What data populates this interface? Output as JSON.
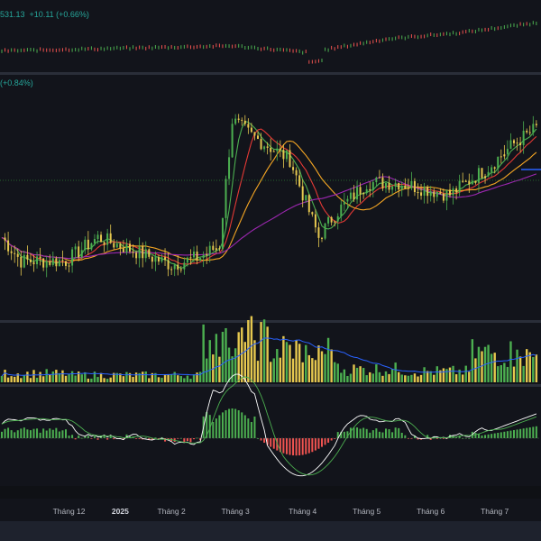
{
  "header": {
    "index_price": "531.13",
    "index_change": "+10.11 (+0.66%)",
    "main_change": "(+0.84%)"
  },
  "x_axis": {
    "ticks": [
      {
        "label": "Tháng 12",
        "bold": false
      },
      {
        "label": "2025",
        "bold": true
      },
      {
        "label": "Tháng 2",
        "bold": false
      },
      {
        "label": "Tháng 3",
        "bold": false
      },
      {
        "label": "Tháng 4",
        "bold": false
      },
      {
        "label": "Tháng 5",
        "bold": false
      },
      {
        "label": "Tháng 6",
        "bold": false
      },
      {
        "label": "Tháng 7",
        "bold": false
      }
    ]
  },
  "colors": {
    "up": "#4caf50",
    "down": "#ef5350",
    "doji": "#e6c84f",
    "ma_fast": "#4caf50",
    "ma_mid": "#e53935",
    "ma_slow": "#f5a623",
    "ma_long": "#9c27b0",
    "vol_ma": "#2962ff",
    "macd": "#ffffff",
    "signal": "#4caf50",
    "hist_up": "#4caf50",
    "hist_down": "#ef5350",
    "resistance": "#2962ff"
  },
  "chart_data": [
    {
      "type": "line",
      "pane": "index-overview",
      "x": [
        "Tháng 12",
        "2025",
        "Tháng 2",
        "Tháng 3",
        "Tháng 4",
        "Tháng 5",
        "Tháng 6",
        "Tháng 7"
      ],
      "series": [
        {
          "values": [
            45,
            46,
            47,
            48,
            44,
            52,
            56,
            62
          ]
        }
      ]
    },
    {
      "type": "candlestick",
      "pane": "price",
      "x": [
        "Tháng 12",
        "2025",
        "Tháng 2",
        "Tháng 3",
        "Tháng 4",
        "Tháng 5",
        "Tháng 6",
        "Tháng 7"
      ],
      "series": [
        {
          "values": [
            46,
            52,
            45,
            82,
            72,
            70,
            68,
            78
          ]
        }
      ],
      "moving_averages": 4,
      "resistance_line": true
    },
    {
      "type": "bar",
      "pane": "volume",
      "x": [
        "Tháng 12",
        "2025",
        "Tháng 2",
        "Tháng 3",
        "Tháng 4",
        "Tháng 5",
        "Tháng 6",
        "Tháng 7"
      ],
      "series": [
        {
          "values": [
            12,
            10,
            10,
            60,
            45,
            18,
            15,
            40
          ]
        }
      ]
    },
    {
      "type": "bar",
      "pane": "macd",
      "x": [
        "Tháng 12",
        "2025",
        "Tháng 2",
        "Tháng 3",
        "Tháng 4",
        "Tháng 5",
        "Tháng 6",
        "Tháng 7"
      ],
      "series": [
        {
          "values": [
            1.5,
            0.2,
            -0.3,
            4.5,
            -3.5,
            1.5,
            0.2,
            1.2
          ]
        }
      ]
    }
  ]
}
